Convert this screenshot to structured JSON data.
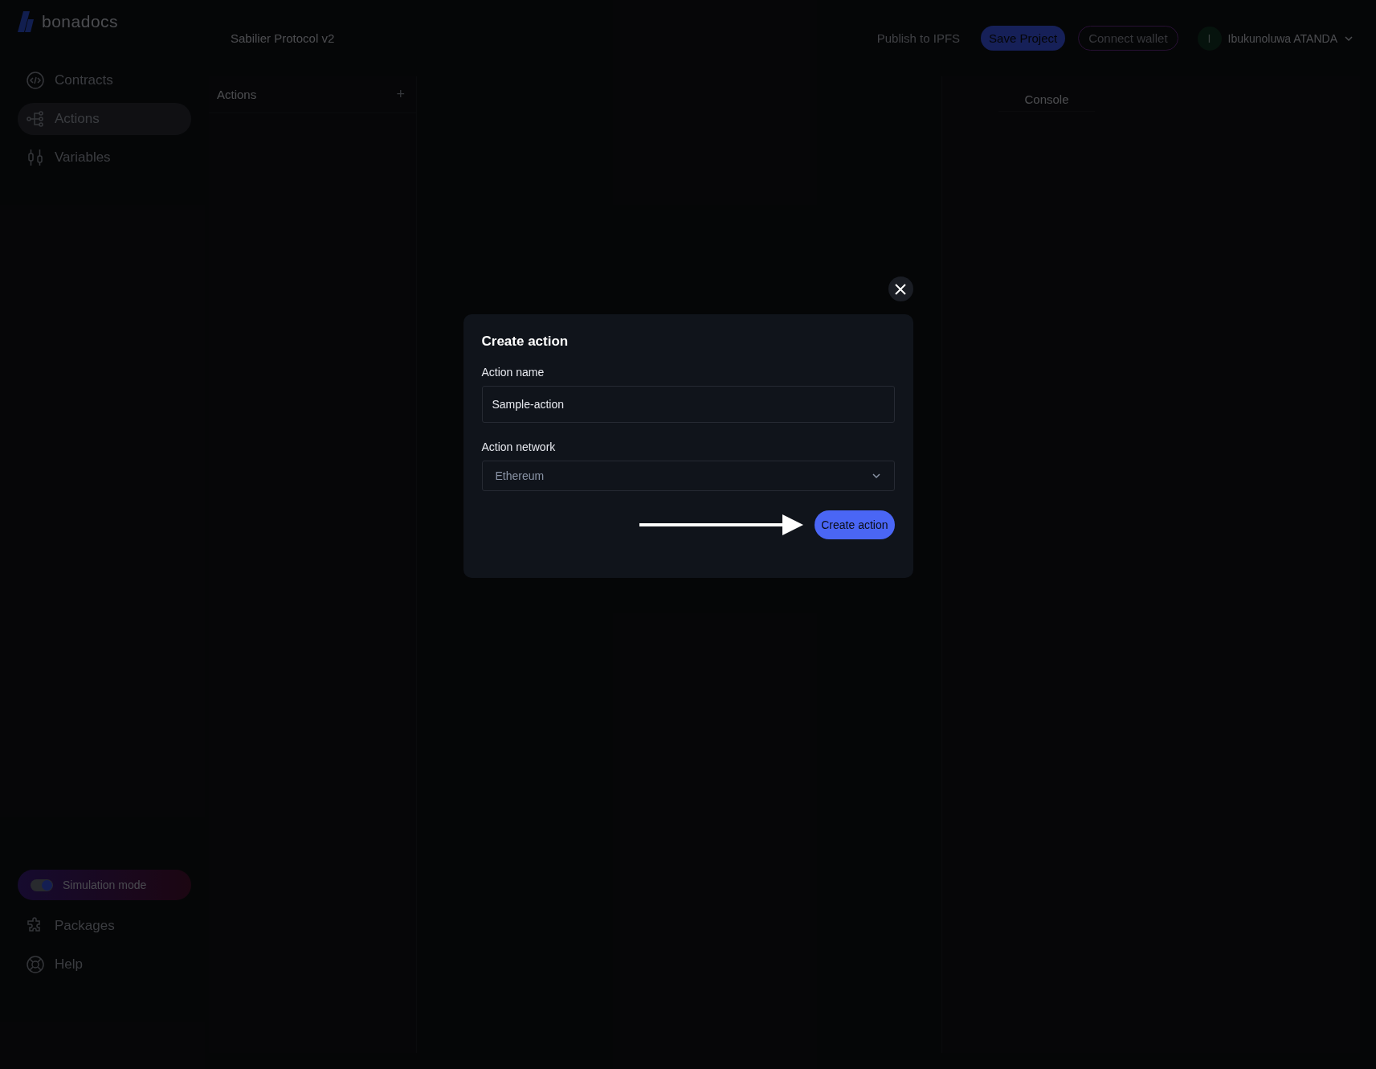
{
  "app": {
    "logo": "bonadocs"
  },
  "sidebar": {
    "items": [
      {
        "kind": "code",
        "label": "Contracts",
        "selected": false
      },
      {
        "kind": "tree",
        "label": "Actions",
        "selected": true
      },
      {
        "kind": "sliders",
        "label": "Variables",
        "selected": false
      }
    ],
    "simulation": {
      "label": "Simulation mode",
      "on": true
    },
    "footer_items": [
      {
        "kind": "puzzle",
        "label": "Packages"
      },
      {
        "kind": "lifebuoy",
        "label": "Help"
      }
    ]
  },
  "header": {
    "project": "Sabilier Protocol v2",
    "publish": "Publish to IPFS",
    "save": "Save Project",
    "connect": "Connect wallet",
    "user": {
      "initial": "I",
      "name": "Ibukunoluwa ATANDA"
    }
  },
  "actions_panel": {
    "title": "Actions",
    "add": "+"
  },
  "console": {
    "tab": "Console"
  },
  "dialog": {
    "title": "Create action",
    "fields": [
      {
        "kind": "text",
        "label": "Action name",
        "value": "Sample-action"
      },
      {
        "kind": "select",
        "label": "Action network",
        "value": "Ethereum"
      }
    ],
    "submit": "Create action"
  }
}
